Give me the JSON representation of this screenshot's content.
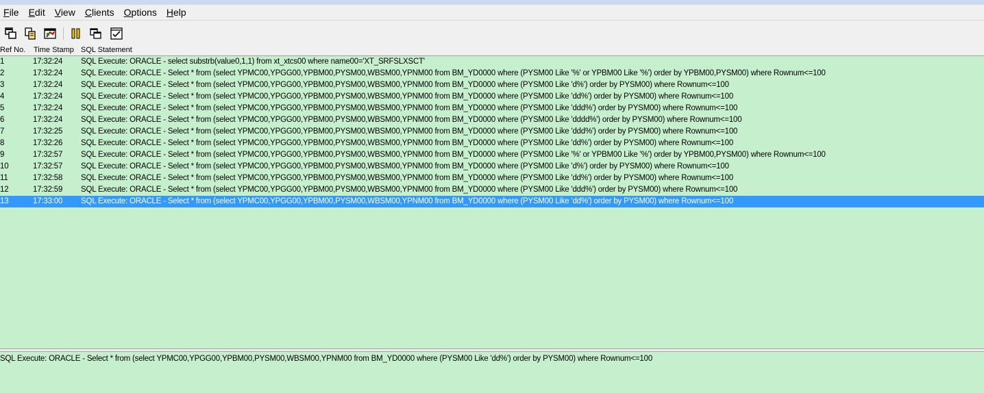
{
  "menu": [
    {
      "key": "F",
      "rest": "ile"
    },
    {
      "key": "E",
      "rest": "dit"
    },
    {
      "key": "V",
      "rest": "iew"
    },
    {
      "key": "C",
      "rest": "lients"
    },
    {
      "key": "O",
      "rest": "ptions"
    },
    {
      "key": "H",
      "rest": "elp"
    }
  ],
  "toolbar": {
    "icons": [
      "copy-to-clipboard-icon",
      "copy-icon",
      "clear-log-icon",
      "pause-icon",
      "windows-icon",
      "checklist-icon"
    ]
  },
  "columns": {
    "ref": "Ref No.",
    "ts": "Time Stamp",
    "sql": "SQL Statement"
  },
  "rows": [
    {
      "ref": "1",
      "ts": "17:32:24",
      "sql": "SQL Execute: ORACLE - select substrb(value0,1,1) from xt_xtcs00 where name00='XT_SRFSLXSCT'"
    },
    {
      "ref": "2",
      "ts": "17:32:24",
      "sql": "SQL Execute: ORACLE - Select * from (select YPMC00,YPGG00,YPBM00,PYSM00,WBSM00,YPNM00 from BM_YD0000 where (PYSM00 Like '%' or YPBM00 Like '%') order by YPBM00,PYSM00) where Rownum<=100"
    },
    {
      "ref": "3",
      "ts": "17:32:24",
      "sql": "SQL Execute: ORACLE - Select * from (select YPMC00,YPGG00,YPBM00,PYSM00,WBSM00,YPNM00 from BM_YD0000 where (PYSM00 Like 'd%') order by PYSM00) where Rownum<=100"
    },
    {
      "ref": "4",
      "ts": "17:32:24",
      "sql": "SQL Execute: ORACLE - Select * from (select YPMC00,YPGG00,YPBM00,PYSM00,WBSM00,YPNM00 from BM_YD0000 where (PYSM00 Like 'dd%') order by PYSM00) where Rownum<=100"
    },
    {
      "ref": "5",
      "ts": "17:32:24",
      "sql": "SQL Execute: ORACLE - Select * from (select YPMC00,YPGG00,YPBM00,PYSM00,WBSM00,YPNM00 from BM_YD0000 where (PYSM00 Like 'ddd%') order by PYSM00) where Rownum<=100"
    },
    {
      "ref": "6",
      "ts": "17:32:24",
      "sql": "SQL Execute: ORACLE - Select * from (select YPMC00,YPGG00,YPBM00,PYSM00,WBSM00,YPNM00 from BM_YD0000 where (PYSM00 Like 'dddd%') order by PYSM00) where Rownum<=100"
    },
    {
      "ref": "7",
      "ts": "17:32:25",
      "sql": "SQL Execute: ORACLE - Select * from (select YPMC00,YPGG00,YPBM00,PYSM00,WBSM00,YPNM00 from BM_YD0000 where (PYSM00 Like 'ddd%') order by PYSM00) where Rownum<=100"
    },
    {
      "ref": "8",
      "ts": "17:32:26",
      "sql": "SQL Execute: ORACLE - Select * from (select YPMC00,YPGG00,YPBM00,PYSM00,WBSM00,YPNM00 from BM_YD0000 where (PYSM00 Like 'dd%') order by PYSM00) where Rownum<=100"
    },
    {
      "ref": "9",
      "ts": "17:32:57",
      "sql": "SQL Execute: ORACLE - Select * from (select YPMC00,YPGG00,YPBM00,PYSM00,WBSM00,YPNM00 from BM_YD0000 where (PYSM00 Like '%' or YPBM00 Like '%') order by YPBM00,PYSM00) where Rownum<=100"
    },
    {
      "ref": "10",
      "ts": "17:32:57",
      "sql": "SQL Execute: ORACLE - Select * from (select YPMC00,YPGG00,YPBM00,PYSM00,WBSM00,YPNM00 from BM_YD0000 where (PYSM00 Like 'd%') order by PYSM00) where Rownum<=100"
    },
    {
      "ref": "11",
      "ts": "17:32:58",
      "sql": "SQL Execute: ORACLE - Select * from (select YPMC00,YPGG00,YPBM00,PYSM00,WBSM00,YPNM00 from BM_YD0000 where (PYSM00 Like 'dd%') order by PYSM00) where Rownum<=100"
    },
    {
      "ref": "12",
      "ts": "17:32:59",
      "sql": "SQL Execute: ORACLE - Select * from (select YPMC00,YPGG00,YPBM00,PYSM00,WBSM00,YPNM00 from BM_YD0000 where (PYSM00 Like 'ddd%') order by PYSM00) where Rownum<=100"
    },
    {
      "ref": "13",
      "ts": "17:33:00",
      "sql": "SQL Execute: ORACLE - Select * from (select YPMC00,YPGG00,YPBM00,PYSM00,WBSM00,YPNM00 from BM_YD0000 where (PYSM00 Like 'dd%') order by PYSM00) where Rownum<=100"
    }
  ],
  "selected_row": 13,
  "detail_text": "SQL Execute: ORACLE - Select * from (select YPMC00,YPGG00,YPBM00,PYSM00,WBSM00,YPNM00 from BM_YD0000 where (PYSM00 Like 'dd%') order by PYSM00) where Rownum<=100",
  "colors": {
    "list_bg": "#c6efce",
    "selection": "#3399ff",
    "chrome": "#f0f0f0"
  }
}
